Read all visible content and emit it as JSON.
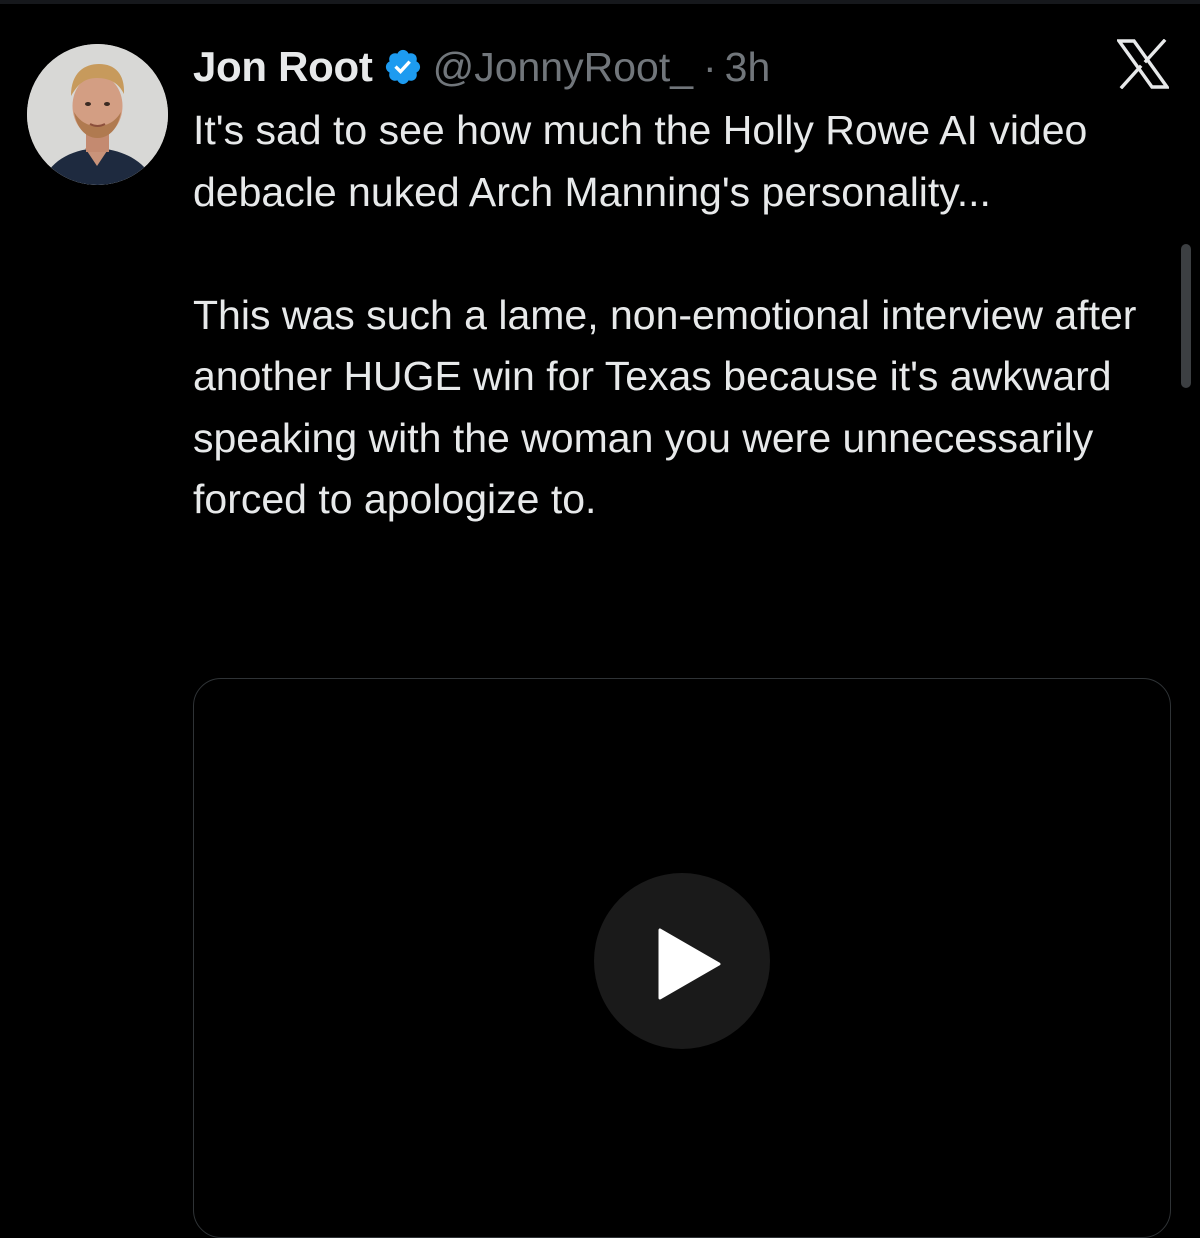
{
  "tweet": {
    "author": {
      "display_name": "Jon Root",
      "handle": "@JonnyRoot_",
      "verified": true
    },
    "separator": "·",
    "timestamp": "3h",
    "text_paragraphs": [
      "It's sad to see how much the Holly Rowe AI video debacle nuked Arch Manning's personality...",
      "This was such a lame, non-emotional interview after another HUGE win for Texas because it's awkward speaking with the woman you were unnecessarily forced to apologize to."
    ],
    "media": {
      "type": "video",
      "play_icon": "play-icon"
    }
  },
  "icons": {
    "verified": "verified-badge-icon",
    "brand": "x-logo-icon"
  },
  "colors": {
    "background": "#000000",
    "text_primary": "#e7e9ea",
    "text_secondary": "#71767b",
    "verified_blue": "#1d9bf0",
    "media_border": "#2f3336"
  }
}
